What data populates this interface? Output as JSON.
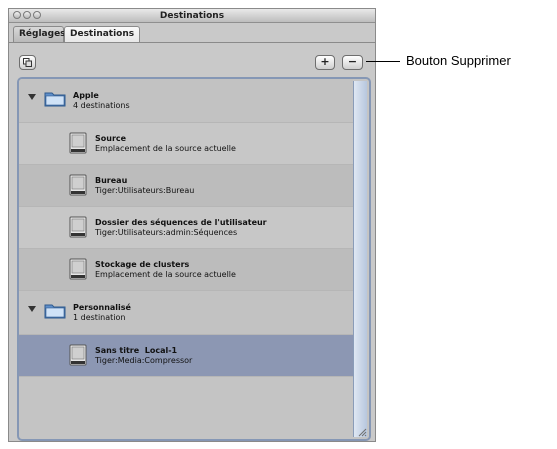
{
  "window": {
    "title": "Destinations"
  },
  "tabs": [
    {
      "label": "Réglages"
    },
    {
      "label": "Destinations"
    }
  ],
  "toolbar": {
    "add_label": "+",
    "remove_label": "−"
  },
  "groups": [
    {
      "name": "Apple",
      "count": "4 destinations",
      "items": [
        {
          "name": "Source",
          "path": "Emplacement de la source actuelle"
        },
        {
          "name": "Bureau",
          "path": "Tiger:Utilisateurs:Bureau"
        },
        {
          "name": "Dossier des séquences de l'utilisateur",
          "path": "Tiger:Utilisateurs:admin:Séquences"
        },
        {
          "name": "Stockage de clusters",
          "path": "Emplacement de la source actuelle"
        }
      ]
    },
    {
      "name": "Personnalisé",
      "count": "1 destination",
      "items": [
        {
          "name": "Sans titre  Local-1",
          "path": "Tiger:Media:Compressor"
        }
      ]
    }
  ],
  "selected_item": "Sans titre  Local-1",
  "callout": {
    "label": "Bouton Supprimer"
  },
  "colors": {
    "selection": "#8c97b3",
    "panel_border": "#8597b5",
    "window_bg": "#c9c9c9"
  }
}
